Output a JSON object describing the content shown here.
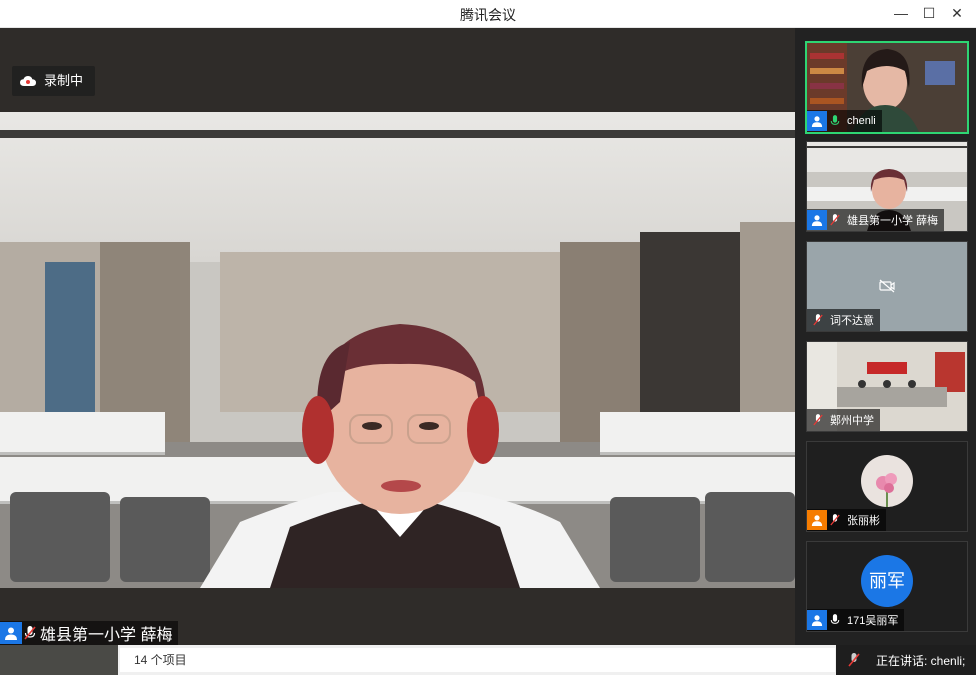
{
  "window": {
    "title": "腾讯会议",
    "minimize": "—",
    "maximize": "☐",
    "close": "✕"
  },
  "recording": {
    "label": "录制中"
  },
  "main_speaker": {
    "name": "雄县第一小学 薛梅"
  },
  "participants": [
    {
      "name": "chenli",
      "mic": "on",
      "has_user_icon": true,
      "active": true
    },
    {
      "name": "雄县第一小学 薛梅",
      "mic": "muted",
      "has_user_icon": true,
      "active": false
    },
    {
      "name": "词不达意",
      "mic": "muted",
      "has_user_icon": false,
      "active": false,
      "video_off": true
    },
    {
      "name": "鄚州中学",
      "mic": "muted",
      "has_user_icon": false,
      "active": false
    },
    {
      "name": "张丽彬",
      "mic": "muted",
      "has_user_icon": true,
      "active": false,
      "avatar": "flower"
    },
    {
      "name": "171吴丽军",
      "mic": "on",
      "has_user_icon": true,
      "active": false,
      "avatar_text": "丽军"
    }
  ],
  "bottom": {
    "item_count": "14 个项目",
    "speaking_label": "正在讲话: chenli;"
  },
  "colors": {
    "accent_blue": "#1b77e6",
    "active_green": "#2ed573",
    "mute_red": "#e53935"
  }
}
